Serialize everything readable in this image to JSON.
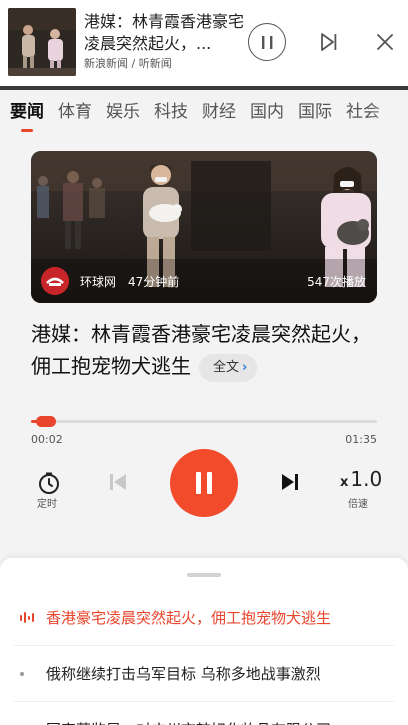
{
  "mini_player": {
    "title": "港媒：林青霞香港豪宅凌晨突然起火，...",
    "source": "新浪新闻 / 听新闻"
  },
  "tabs": [
    "要闻",
    "体育",
    "娱乐",
    "科技",
    "财经",
    "国内",
    "国际",
    "社会"
  ],
  "active_tab": "要闻",
  "video": {
    "source_name": "环球网",
    "published": "47分钟前",
    "plays": "547次播放"
  },
  "headline": "港媒：林青霞香港豪宅凌晨突然起火，佣工抱宠物犬逃生",
  "fulltext_label": "全文",
  "player": {
    "current_time": "00:02",
    "total_time": "01:35",
    "progress_fraction": 0.021,
    "timer_label": "定时",
    "speed_value": "1.0",
    "speed_prefix": "x",
    "speed_label": "倍速"
  },
  "playlist": [
    {
      "title": "香港豪宅凌晨突然起火，佣工抱宠物犬逃生",
      "playing": true
    },
    {
      "title": "俄称继续打击乌军目标 乌称多地战事激烈",
      "playing": false
    },
    {
      "title": "国家药监局：对广州市韩妃化妆品有限公司...",
      "playing": false
    }
  ],
  "colors": {
    "accent": "#e8452c",
    "play_button": "#f14b2c",
    "fulltext_chevron": "#2f79d8"
  }
}
